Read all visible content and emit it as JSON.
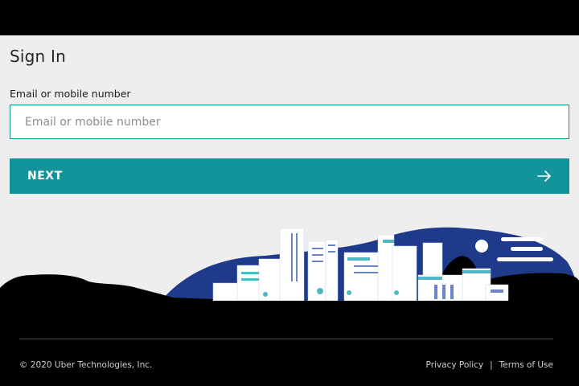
{
  "header": {
    "title": "Sign In"
  },
  "form": {
    "email_label": "Email or mobile number",
    "email_placeholder": "Email or mobile number",
    "email_value": "",
    "next_label": "NEXT",
    "next_icon": "arrow-right-icon"
  },
  "illustration": {
    "name": "city-skyline-illustration",
    "colors": {
      "hill": "#1f3a8a",
      "ground": "#000000",
      "buildings": "#ffffff",
      "accent": "#4fb8c4"
    }
  },
  "footer": {
    "copyright": "© 2020 Uber Technologies, Inc.",
    "privacy_label": "Privacy Policy",
    "separator": "|",
    "terms_label": "Terms of Use"
  },
  "colors": {
    "accent": "#13939a",
    "background": "#eeeeee",
    "footer": "#000000"
  }
}
